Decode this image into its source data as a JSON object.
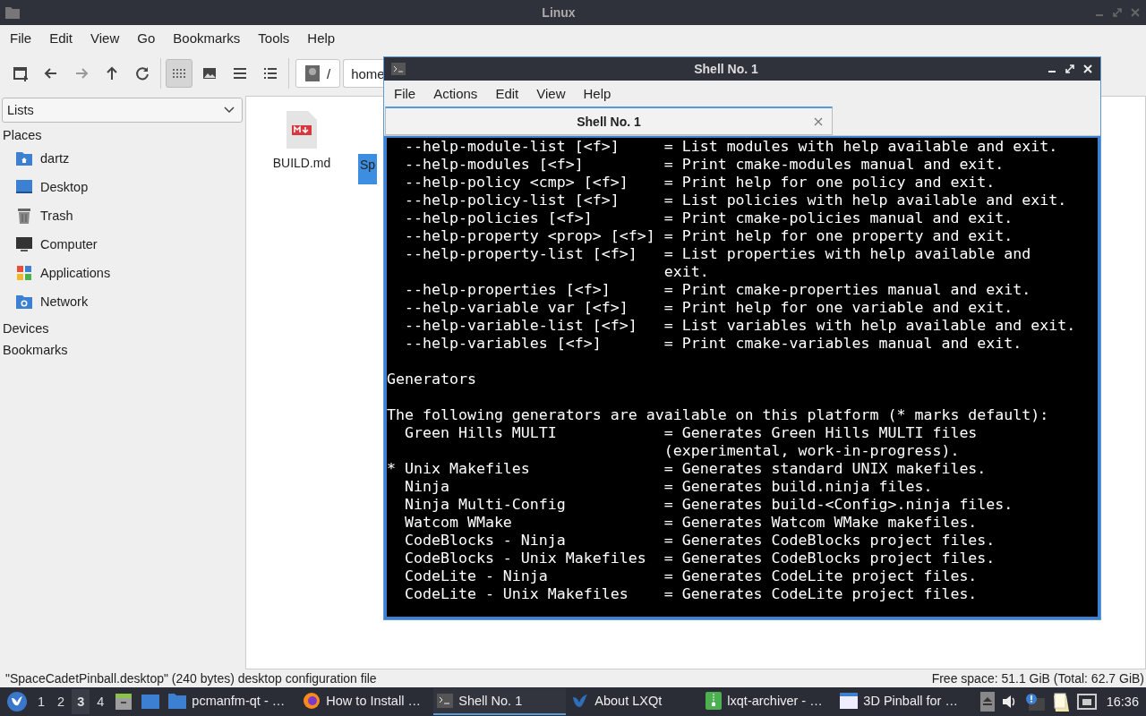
{
  "window": {
    "title": "Linux"
  },
  "menu": [
    "File",
    "Edit",
    "View",
    "Go",
    "Bookmarks",
    "Tools",
    "Help"
  ],
  "toolbar": {
    "view_modes": [
      {
        "kind": "icons",
        "selected": true
      },
      {
        "kind": "thumbnails",
        "selected": false
      },
      {
        "kind": "compact",
        "selected": false
      },
      {
        "kind": "details",
        "selected": false
      }
    ],
    "path": [
      "/",
      "home"
    ]
  },
  "side_pane": {
    "dropdown": "Lists",
    "sections": [
      {
        "title": "Places",
        "items": [
          {
            "label": "dartz",
            "kind": "home"
          },
          {
            "label": "Desktop",
            "kind": "desktop"
          },
          {
            "label": "Trash",
            "kind": "trash"
          },
          {
            "label": "Computer",
            "kind": "computer"
          },
          {
            "label": "Applications",
            "kind": "apps"
          },
          {
            "label": "Network",
            "kind": "network"
          }
        ]
      },
      {
        "title": "Devices"
      },
      {
        "title": "Bookmarks"
      }
    ]
  },
  "files": [
    {
      "name": "BUILD.md",
      "selected": false
    },
    {
      "name": "Sp",
      "selected": true
    }
  ],
  "status_bar": {
    "left": "\"SpaceCadetPinball.desktop\" (240 bytes) desktop configuration file",
    "right": "Free space: 51.1 GiB (Total: 62.7 GiB)"
  },
  "terminal": {
    "title": "Shell No. 1",
    "menu": [
      "File",
      "Actions",
      "Edit",
      "View",
      "Help"
    ],
    "tabs": [
      {
        "label": "Shell No. 1",
        "selected": true
      }
    ],
    "blocks": [
      [
        "  --help-module-list [<f>]     = List modules with help available and exit.",
        "  --help-modules [<f>]         = Print cmake-modules manual and exit.",
        "  --help-policy <cmp> [<f>]    = Print help for one policy and exit.",
        "  --help-policy-list [<f>]     = List policies with help available and exit.",
        "  --help-policies [<f>]        = Print cmake-policies manual and exit.",
        "  --help-property <prop> [<f>] = Print help for one property and exit.",
        "  --help-property-list [<f>]   = List properties with help available and",
        "                               exit.",
        "  --help-properties [<f>]      = Print cmake-properties manual and exit.",
        "  --help-variable var [<f>]    = Print help for one variable and exit.",
        "  --help-variable-list [<f>]   = List variables with help available and exit.",
        "  --help-variables [<f>]       = Print cmake-variables manual and exit."
      ],
      [
        "Generators"
      ],
      [
        "The following generators are available on this platform (* marks default):",
        "  Green Hills MULTI            = Generates Green Hills MULTI files",
        "                               (experimental, work-in-progress).",
        "* Unix Makefiles               = Generates standard UNIX makefiles.",
        "  Ninja                        = Generates build.ninja files.",
        "  Ninja Multi-Config           = Generates build-<Config>.ninja files.",
        "  Watcom WMake                 = Generates Watcom WMake makefiles.",
        "  CodeBlocks - Ninja           = Generates CodeBlocks project files.",
        "  CodeBlocks - Unix Makefiles  = Generates CodeBlocks project files.",
        "  CodeLite - Ninja             = Generates CodeLite project files.",
        "  CodeLite - Unix Makefiles    = Generates CodeLite project files."
      ]
    ]
  },
  "taskbar": {
    "desktops": [
      {
        "label": "1",
        "selected": false
      },
      {
        "label": "2",
        "selected": false
      },
      {
        "label": "3",
        "selected": true
      },
      {
        "label": "4",
        "selected": false
      }
    ],
    "tasks": [
      {
        "label": "pcmanfm-qt - …",
        "kind": "folder",
        "selected": false
      },
      {
        "label": "How to Install …",
        "kind": "browser",
        "selected": false
      },
      {
        "label": "Shell No. 1",
        "kind": "terminal",
        "selected": true
      },
      {
        "label": "About LXQt",
        "kind": "lxqt",
        "selected": false
      },
      {
        "label": "lxqt-archiver - …",
        "kind": "archive",
        "selected": false
      },
      {
        "label": "3D Pinball for …",
        "kind": "window",
        "selected": false
      }
    ],
    "clock": "16:36"
  }
}
